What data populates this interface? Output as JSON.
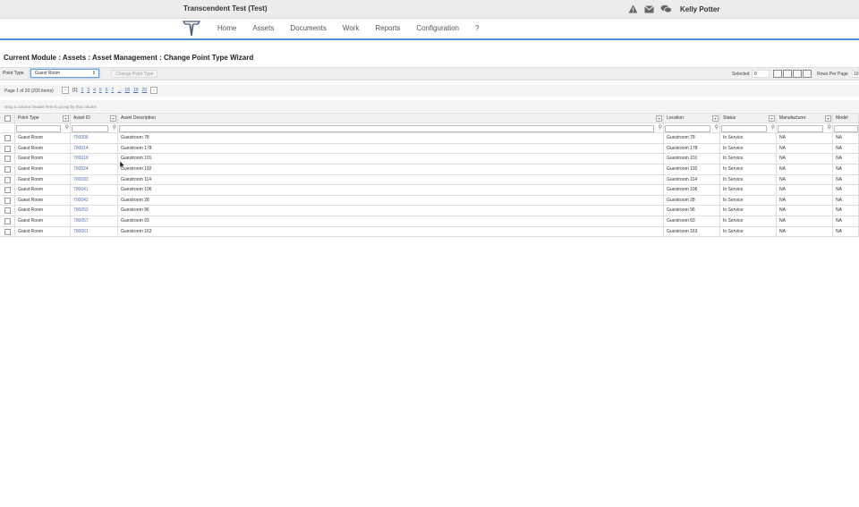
{
  "app": {
    "title": "Transcendent Test (Test)",
    "user": "Kelly Potter"
  },
  "icons": {
    "alert": "warning-icon",
    "mail": "mail-icon",
    "chat": "chat-icon"
  },
  "nav": {
    "items": [
      "Home",
      "Assets",
      "Documents",
      "Work",
      "Reports",
      "Configuration",
      "?"
    ]
  },
  "breadcrumb": "Current Module : Assets : Asset Management : Change Point Type Wizard",
  "toolbar": {
    "point_type_label": "Point Type",
    "point_type_value": "Guest Room",
    "change_button": "Change Point Type",
    "selected_label": "Selected",
    "selected_value": "0",
    "rows_per_page_label": "Rows Per Page",
    "rows_per_page_value": "10"
  },
  "pager": {
    "info": "Page 1 of 20 (200 items)",
    "pages": [
      "[1]",
      "2",
      "3",
      "4",
      "5",
      "6",
      "7",
      "...",
      "18",
      "19",
      "20"
    ]
  },
  "group_hint": "Drag a column header here to group by that column",
  "grid": {
    "columns": [
      "Point Type",
      "Asset ID",
      "Asset Description",
      "Location",
      "Status",
      "Manufacturer",
      "Model"
    ],
    "rows": [
      [
        "Guest Room",
        "700006",
        "Guestroom 78",
        "Guestroom 78",
        "In Service",
        "NA",
        "NA"
      ],
      [
        "Guest Room",
        "700014",
        "Guestroom 178",
        "Guestroom 178",
        "In Service",
        "NA",
        "NA"
      ],
      [
        "Guest Room",
        "700019",
        "Guestroom 101",
        "Guestroom 101",
        "In Service",
        "NA",
        "NA"
      ],
      [
        "Guest Room",
        "700024",
        "Guestroom 192",
        "Guestroom 192",
        "In Service",
        "NA",
        "NA"
      ],
      [
        "Guest Room",
        "700033",
        "Guestroom 114",
        "Guestroom 114",
        "In Service",
        "NA",
        "NA"
      ],
      [
        "Guest Room",
        "700041",
        "Guestroom 106",
        "Guestroom 106",
        "In Service",
        "NA",
        "NA"
      ],
      [
        "Guest Room",
        "700042",
        "Guestroom 28",
        "Guestroom 28",
        "In Service",
        "NA",
        "NA"
      ],
      [
        "Guest Room",
        "700053",
        "Guestroom 96",
        "Guestroom 96",
        "In Service",
        "NA",
        "NA"
      ],
      [
        "Guest Room",
        "700057",
        "Guestroom 93",
        "Guestroom 93",
        "In Service",
        "NA",
        "NA"
      ],
      [
        "Guest Room",
        "700061",
        "Guestroom 163",
        "Guestroom 163",
        "In Service",
        "NA",
        "NA"
      ]
    ]
  },
  "colors": {
    "accent": "#4d90d6",
    "link": "#4a6fb8",
    "topbar": "#ececec"
  }
}
